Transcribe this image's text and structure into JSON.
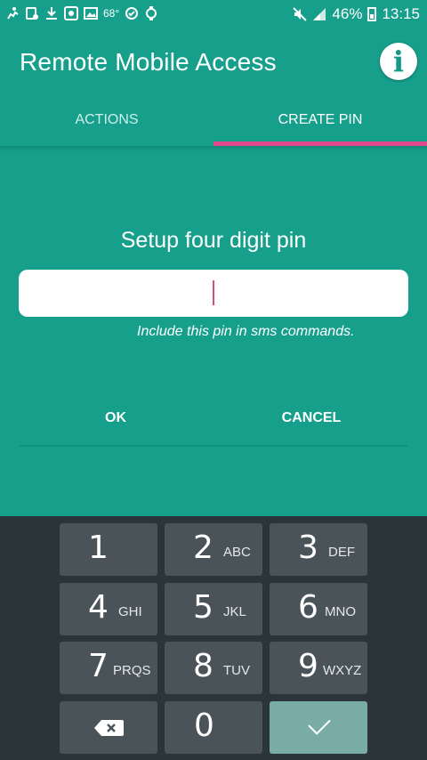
{
  "status_bar": {
    "temperature": "68°",
    "battery": "46%",
    "time": "13:15",
    "icons": [
      "running-icon",
      "rotate-icon",
      "download-icon",
      "security-icon",
      "image-icon",
      "check-circle-icon",
      "watch-icon",
      "mute-icon",
      "signal-icon",
      "battery-icon"
    ]
  },
  "app_bar": {
    "title": "Remote Mobile Access",
    "info_icon": "i"
  },
  "tabs": [
    {
      "label": "ACTIONS",
      "selected": false
    },
    {
      "label": "CREATE PIN",
      "selected": true
    }
  ],
  "dialog": {
    "title": "Setup four digit pin",
    "pin_value": "",
    "hint": "Include this pin in sms commands.",
    "ok_label": "OK",
    "cancel_label": "CANCEL"
  },
  "keyboard": {
    "keys": [
      {
        "digit": "1",
        "letters": ""
      },
      {
        "digit": "2",
        "letters": "ABC"
      },
      {
        "digit": "3",
        "letters": "DEF"
      },
      {
        "digit": "4",
        "letters": "GHI"
      },
      {
        "digit": "5",
        "letters": "JKL"
      },
      {
        "digit": "6",
        "letters": "MNO"
      },
      {
        "digit": "7",
        "letters": "PRQS"
      },
      {
        "digit": "8",
        "letters": "TUV"
      },
      {
        "digit": "9",
        "letters": "WXYZ"
      },
      {
        "digit": "0",
        "letters": ""
      }
    ],
    "backspace_icon": "backspace-icon",
    "enter_icon": "check-icon"
  },
  "colors": {
    "primary": "#16a08c",
    "accent": "#e0488e",
    "keyboard_bg": "#2b3438",
    "key_bg": "#4a5358",
    "enter_key_bg": "#7aaca6"
  }
}
